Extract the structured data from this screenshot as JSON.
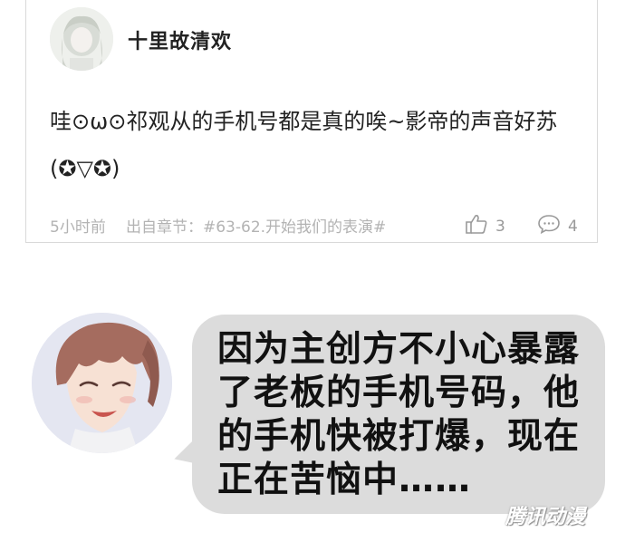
{
  "comment": {
    "username": "十里故清欢",
    "text": "哇⊙ω⊙祁观从的手机号都是真的唉~影帝的声音好苏(✪▽✪)",
    "time": "5小时前",
    "chapter": "出自章节：#63-62.开始我们的表演#",
    "likes": "3",
    "replies": "4"
  },
  "speech": {
    "text": "因为主创方不小心暴露了老板的手机号码，他的手机快被打爆，现在正在苦恼中……"
  },
  "watermark": "腾讯动漫",
  "icons": {
    "like": "thumbs-up-icon",
    "comment": "speech-bubble-icon"
  },
  "colors": {
    "bubble": "#dcdcdc",
    "meta_text": "#b3b3b3",
    "text": "#222222"
  }
}
